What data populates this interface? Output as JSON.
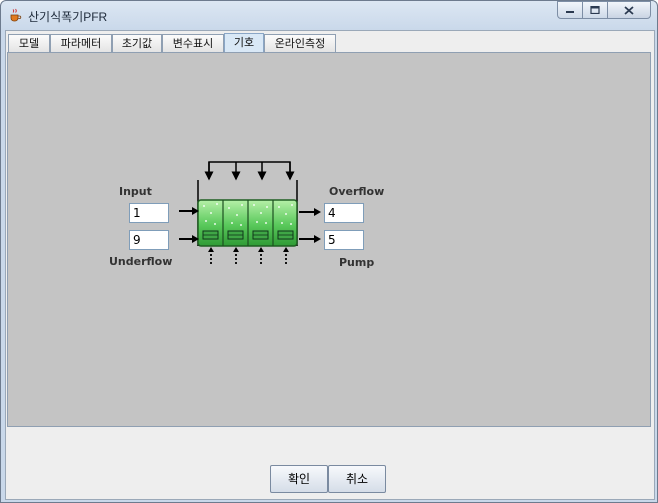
{
  "window": {
    "title": "산기식폭기PFR"
  },
  "tabs": [
    {
      "label": "모델"
    },
    {
      "label": "파라메터"
    },
    {
      "label": "초기값"
    },
    {
      "label": "변수표시"
    },
    {
      "label": "기호"
    },
    {
      "label": "온라인측정"
    }
  ],
  "active_tab": "기호",
  "symbol_panel": {
    "input_label": "Input",
    "input_value": "1",
    "underflow_label": "Underflow",
    "underflow_value": "9",
    "overflow_label": "Overflow",
    "overflow_value": "4",
    "pump_label": "Pump",
    "pump_value": "5"
  },
  "buttons": {
    "ok": "확인",
    "cancel": "취소"
  },
  "icons": {
    "app": "java-coffee-cup-icon",
    "minimize": "minimize-icon",
    "maximize": "maximize-icon",
    "close": "close-icon"
  },
  "colors": {
    "panel_bg": "#c4c4c4",
    "tank_green": "#4cc24c",
    "active_tab": "#d9e8f6"
  }
}
